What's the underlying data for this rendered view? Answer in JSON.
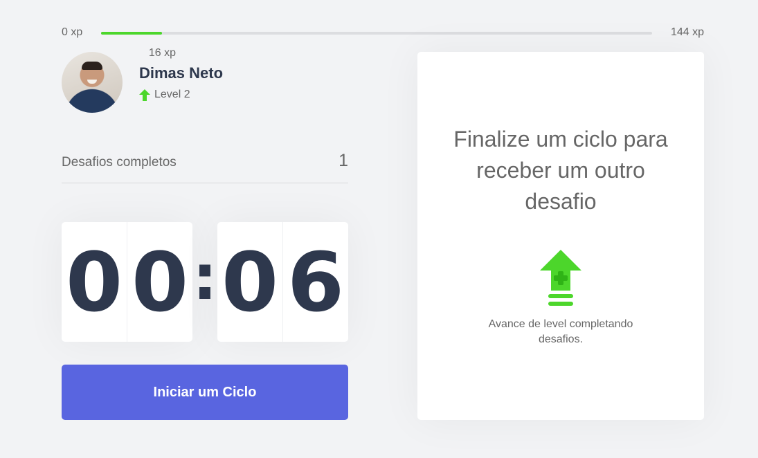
{
  "xp": {
    "min_label": "0 xp",
    "max_label": "144 xp",
    "current_label": "16 xp",
    "current": 16,
    "max": 144
  },
  "profile": {
    "name": "Dimas Neto",
    "level_label": "Level 2",
    "avatar_icon": "user-avatar-photo",
    "level_icon": "level-up-arrow-icon"
  },
  "challenges": {
    "label": "Desafios completos",
    "count": "1"
  },
  "countdown": {
    "minute_left": "0",
    "minute_right": "0",
    "separator": ":",
    "second_left": "0",
    "second_right": "6"
  },
  "start_button": {
    "label": "Iniciar um Ciclo"
  },
  "challenge_card": {
    "title": "Finalize um ciclo para receber um outro desafio",
    "hint": "Avance de level completando desafios.",
    "icon": "level-up-icon"
  },
  "colors": {
    "background": "#f2f3f5",
    "accent_blue": "#5965e0",
    "accent_green": "#4cd62b",
    "title_dark": "#2e384d",
    "text": "#666666"
  }
}
